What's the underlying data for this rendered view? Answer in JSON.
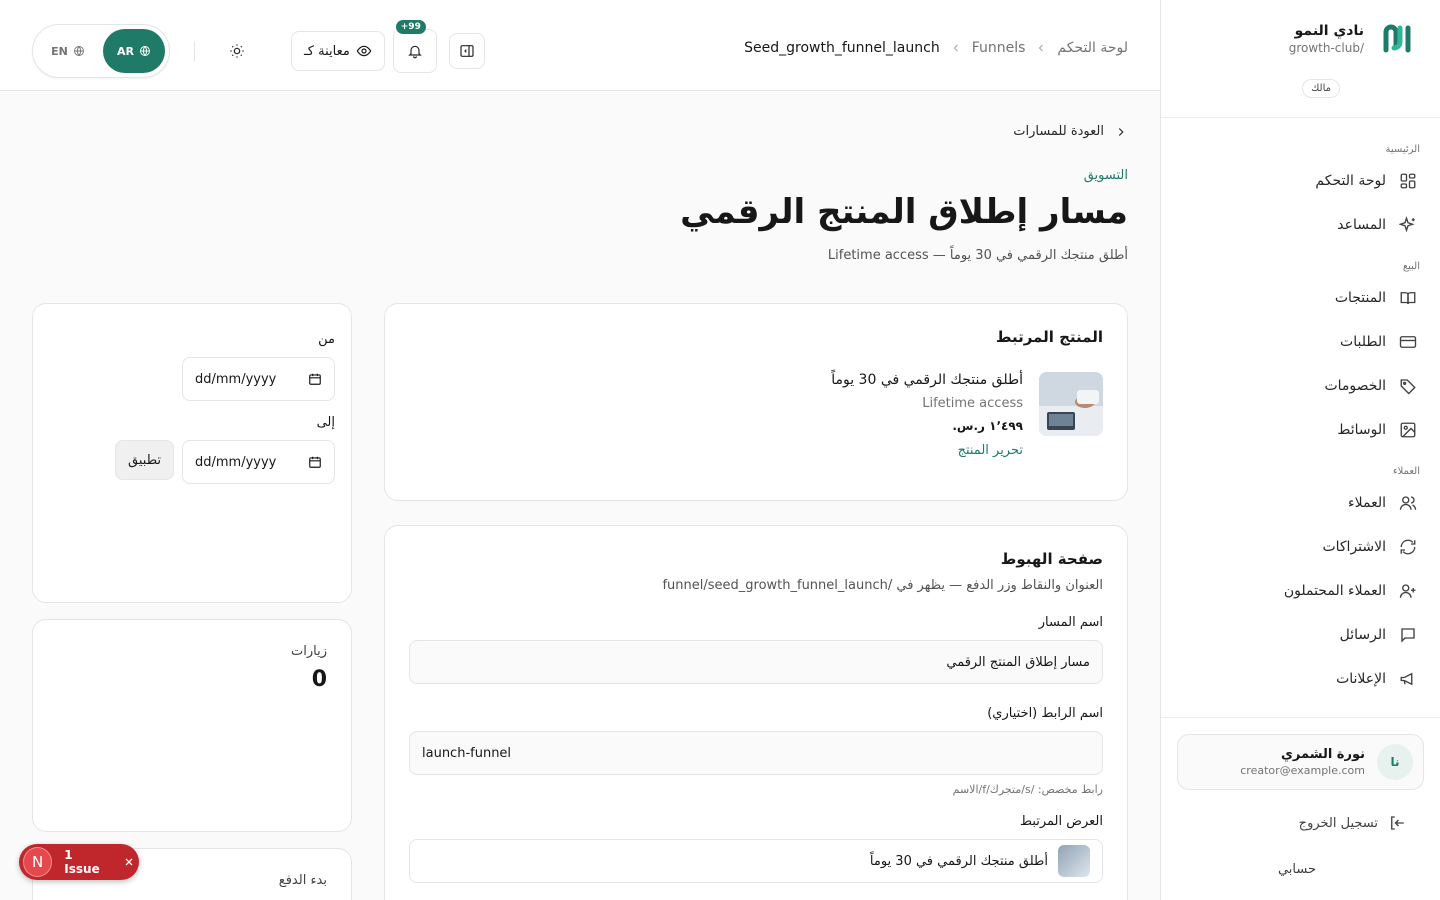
{
  "brand": {
    "name": "نادي النمو",
    "slug": "growth-club/",
    "role": "مالك",
    "accent": "#1f7a68"
  },
  "nav": {
    "sections": [
      {
        "title": "الرئيسية",
        "items": [
          {
            "label": "لوحة التحكم",
            "icon": "dashboard-icon"
          },
          {
            "label": "المساعد",
            "icon": "sparkles-icon"
          }
        ]
      },
      {
        "title": "البيع",
        "items": [
          {
            "label": "المنتجات",
            "icon": "book-icon"
          },
          {
            "label": "الطلبات",
            "icon": "credit-card-icon"
          },
          {
            "label": "الخصومات",
            "icon": "tag-icon"
          },
          {
            "label": "الوسائط",
            "icon": "image-icon"
          }
        ]
      },
      {
        "title": "العملاء",
        "items": [
          {
            "label": "العملاء",
            "icon": "users-icon"
          },
          {
            "label": "الاشتراكات",
            "icon": "refresh-icon"
          },
          {
            "label": "العملاء المحتملون",
            "icon": "user-plus-icon"
          },
          {
            "label": "الرسائل",
            "icon": "message-icon"
          },
          {
            "label": "الإعلانات",
            "icon": "megaphone-icon"
          }
        ]
      }
    ]
  },
  "user": {
    "initials": "نا",
    "name": "نورة الشمري",
    "email": "creator@example.com"
  },
  "sidebar_footer": {
    "logout": "تسجيل الخروج",
    "account": "حسابي"
  },
  "breadcrumb": {
    "root": "لوحة التحكم",
    "section": "Funnels",
    "current": "Seed_growth_funnel_launch"
  },
  "topbar": {
    "lang_ar": "AR",
    "lang_en": "EN",
    "preview_label": "معاينة كـ",
    "notifications_badge": "+99"
  },
  "header": {
    "back": "العودة للمسارات",
    "eyebrow": "التسويق",
    "title": "مسار إطلاق المنتج الرقمي",
    "subtitle": "أطلق منتجك الرقمي في 30 يوماً — Lifetime access"
  },
  "product_card": {
    "title": "المنتج المرتبط",
    "name": "أطلق منتجك الرقمي في 30 يوماً",
    "sub": "Lifetime access",
    "price": "١٬٤٩٩ ر.س.",
    "edit": "تحرير المنتج"
  },
  "landing_card": {
    "title": "صفحة الهبوط",
    "desc": "العنوان والنقاط وزر الدفع — يظهر في /funnel/seed_growth_funnel_launch",
    "name_label": "اسم المسار",
    "name_value": "مسار إطلاق المنتج الرقمي",
    "slug_label": "اسم الرابط (اختياري)",
    "slug_value": "launch-funnel",
    "slug_hint": "رابط مخصص: /s/متجرك/f/الاسم",
    "offer_label": "العرض المرتبط",
    "offer_value": "أطلق منتجك الرقمي في 30 يوماً"
  },
  "date_filter": {
    "from_label": "من",
    "to_label": "إلى",
    "from_placeholder": "dd/mm/yyyy",
    "to_placeholder": "dd/mm/yyyy",
    "apply": "تطبيق"
  },
  "stats": {
    "visits_label": "زيارات",
    "visits_value": "0",
    "checkout_label": "بدء الدفع"
  },
  "issue": {
    "letter": "N",
    "label": "1 Issue"
  }
}
